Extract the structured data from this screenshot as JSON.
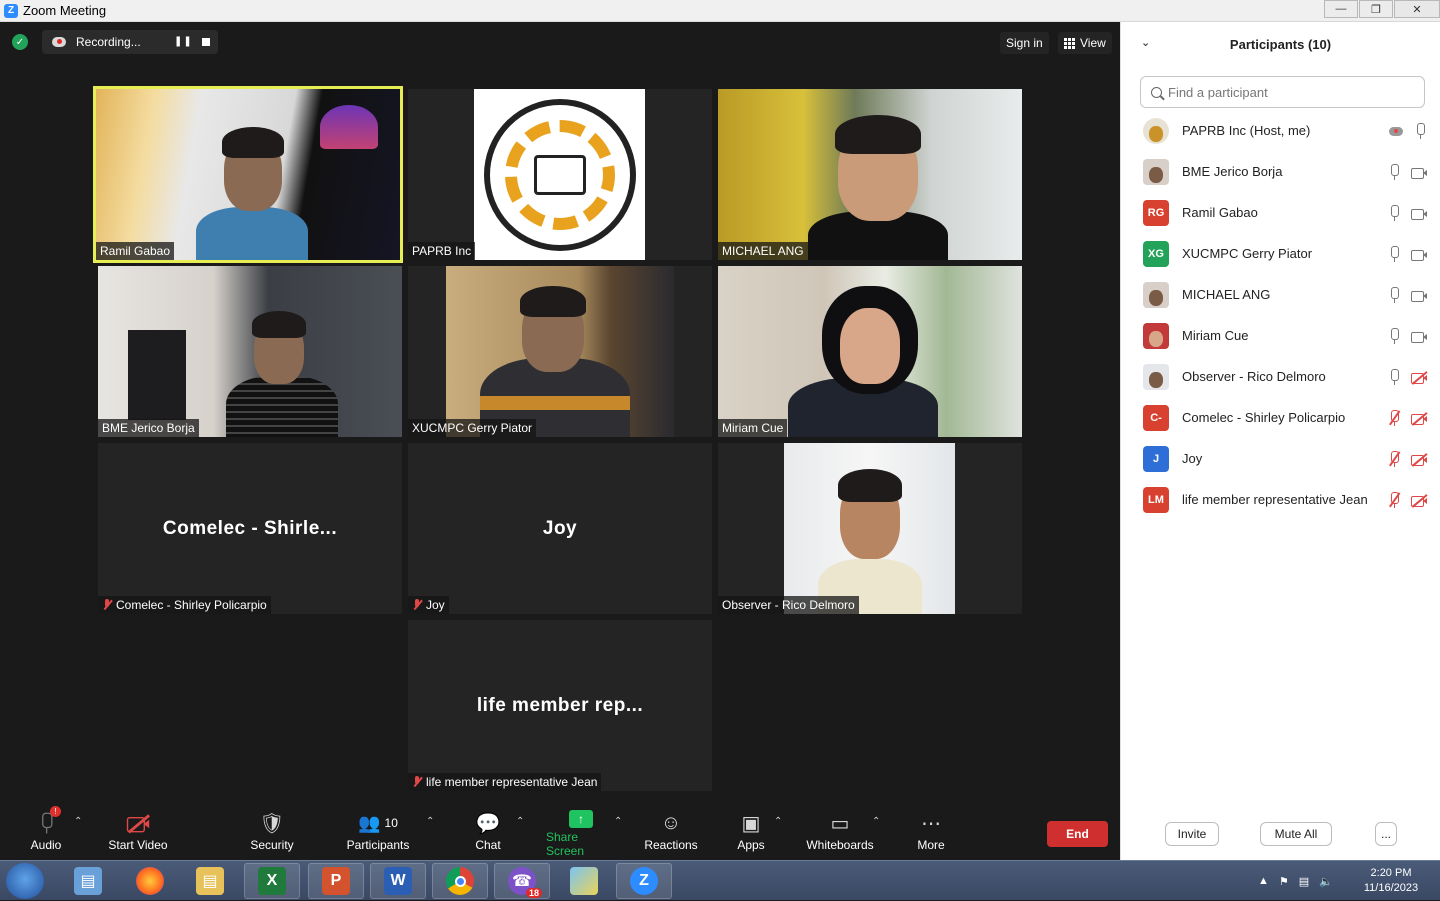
{
  "window": {
    "title": "Zoom Meeting",
    "controls": [
      "minimize",
      "maximize",
      "close"
    ]
  },
  "topbar": {
    "recording_label": "Recording...",
    "sign_in": "Sign in",
    "view": "View"
  },
  "tiles": [
    {
      "name": "Ramil Gabao",
      "type": "video",
      "active": true
    },
    {
      "name": "PAPRB Inc",
      "type": "logo"
    },
    {
      "name": "MICHAEL ANG",
      "type": "video"
    },
    {
      "name": "BME Jerico Borja",
      "type": "video"
    },
    {
      "name": "XUCMPC Gerry Piator",
      "type": "video"
    },
    {
      "name": "Miriam Cue",
      "type": "video"
    },
    {
      "name": "Comelec - Shirley Policarpio",
      "type": "placeholder",
      "center_text": "Comelec - Shirle...",
      "muted": true
    },
    {
      "name": "Joy",
      "type": "placeholder",
      "center_text": "Joy",
      "muted": true
    },
    {
      "name": "Observer - Rico Delmoro",
      "type": "photo"
    },
    {
      "name": "life member representative Jean",
      "type": "placeholder",
      "center_text": "life member rep...",
      "muted": true
    }
  ],
  "toolbar": {
    "audio": "Audio",
    "start_video": "Start Video",
    "security": "Security",
    "participants": "Participants",
    "participants_count": "10",
    "chat": "Chat",
    "share_screen": "Share Screen",
    "reactions": "Reactions",
    "apps": "Apps",
    "whiteboards": "Whiteboards",
    "more": "More",
    "end": "End"
  },
  "panel": {
    "title": "Participants (10)",
    "search_placeholder": "Find a participant",
    "participants": [
      {
        "name": "PAPRB Inc (Host, me)",
        "avatar": "photo",
        "mic": "on",
        "cam": "none",
        "recording": true
      },
      {
        "name": "BME Jerico Borja",
        "avatar": "photo",
        "mic": "on",
        "cam": "on"
      },
      {
        "name": "Ramil Gabao",
        "avatar": "RG",
        "avatar_color": "#d8412f",
        "mic": "on",
        "cam": "on"
      },
      {
        "name": "XUCMPC Gerry Piator",
        "avatar": "XG",
        "avatar_color": "#23a35a",
        "mic": "on",
        "cam": "on"
      },
      {
        "name": "MICHAEL ANG",
        "avatar": "photo",
        "mic": "on",
        "cam": "on"
      },
      {
        "name": "Miriam Cue",
        "avatar": "photo",
        "mic": "on",
        "cam": "on"
      },
      {
        "name": "Observer - Rico Delmoro",
        "avatar": "photo",
        "mic": "on",
        "cam": "off"
      },
      {
        "name": "Comelec - Shirley Policarpio",
        "avatar": "C-",
        "avatar_color": "#d8412f",
        "mic": "off",
        "cam": "off"
      },
      {
        "name": "Joy",
        "avatar": "J",
        "avatar_color": "#2d6fd6",
        "mic": "off",
        "cam": "off"
      },
      {
        "name": "life member representative Jean",
        "avatar": "LM",
        "avatar_color": "#d8412f",
        "mic": "off",
        "cam": "off"
      }
    ],
    "invite": "Invite",
    "mute_all": "Mute All",
    "more": "..."
  },
  "taskbar": {
    "apps": [
      "explorer",
      "firefox",
      "folder",
      "excel",
      "powerpoint",
      "word",
      "chrome",
      "viber",
      "paint",
      "zoom"
    ],
    "viber_badge": "18",
    "time": "2:20 PM",
    "date": "11/16/2023"
  },
  "colors": {
    "accent": "#2d8cff",
    "active_speaker": "#e6ee53",
    "end": "#d02f2f",
    "share": "#1fc35f",
    "muted": "#e04848"
  }
}
